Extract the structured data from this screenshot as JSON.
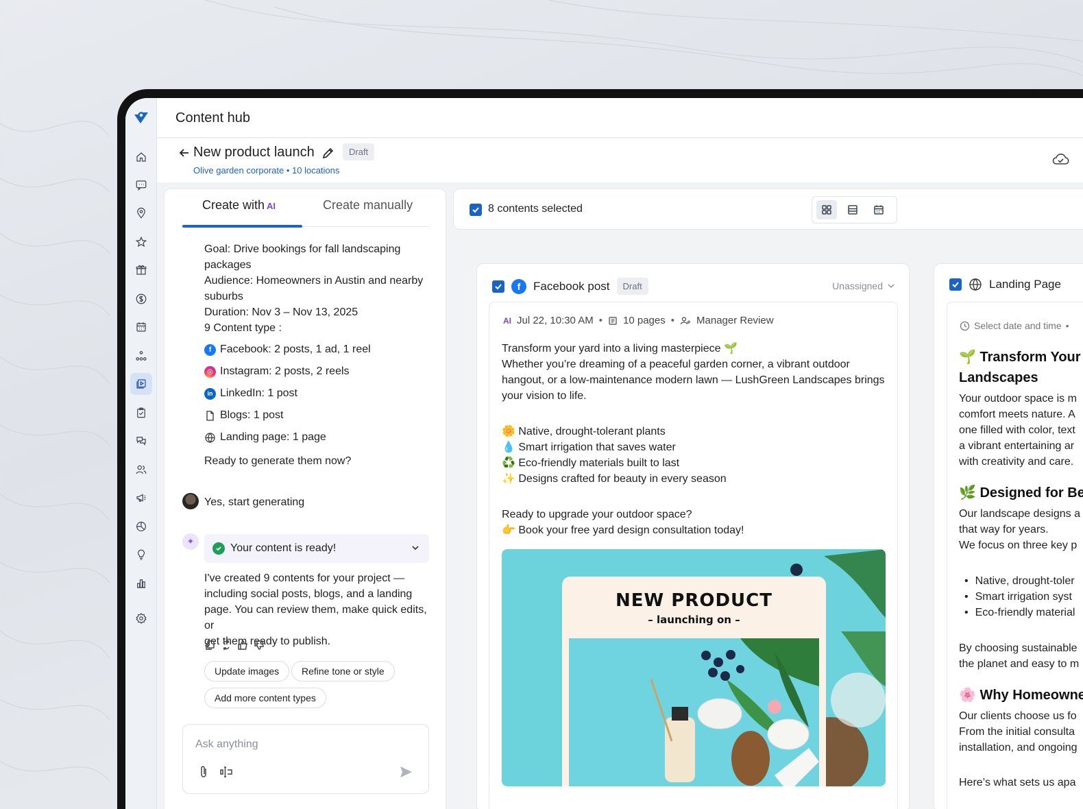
{
  "app": {
    "title": "Content hub"
  },
  "project": {
    "title": "New product launch",
    "status": "Draft",
    "subtitle": "Olive garden corporate • 10 locations"
  },
  "sidebar": {
    "items": [
      {
        "icon": "home-icon"
      },
      {
        "icon": "messages-icon"
      },
      {
        "icon": "location-icon"
      },
      {
        "icon": "star-icon"
      },
      {
        "icon": "gift-icon"
      },
      {
        "icon": "dollar-icon"
      },
      {
        "icon": "calendar-icon"
      },
      {
        "icon": "network-icon"
      },
      {
        "icon": "content-icon",
        "active": true
      },
      {
        "icon": "checklist-icon"
      },
      {
        "icon": "chat-icon"
      },
      {
        "icon": "users-icon"
      },
      {
        "icon": "megaphone-icon"
      },
      {
        "icon": "pie-chart-icon"
      },
      {
        "icon": "lightbulb-icon"
      },
      {
        "icon": "bar-chart-icon"
      },
      {
        "icon": "settings-icon"
      }
    ]
  },
  "left_panel": {
    "tabs": [
      {
        "label": "Create with",
        "ai_mark": "AI",
        "active": true
      },
      {
        "label": "Create manually",
        "active": false
      }
    ],
    "brief": [
      "Goal: Drive bookings for fall landscaping",
      "packages",
      "Audience: Homeowners in Austin and nearby",
      "suburbs",
      "Duration: Nov 3 – Nov 13, 2025",
      "9 Content type :"
    ],
    "content_types": [
      {
        "icon": "facebook-icon",
        "label": "Facebook: 2 posts, 1 ad, 1 reel"
      },
      {
        "icon": "instagram-icon",
        "label": "Instagram: 2 posts, 2 reels"
      },
      {
        "icon": "linkedin-icon",
        "label": "LinkedIn: 1 post"
      },
      {
        "icon": "document-icon",
        "label": "Blogs: 1 post"
      },
      {
        "icon": "globe-icon",
        "label": "Landing page: 1 page"
      }
    ],
    "question": "Ready to generate them now?",
    "user_reply": "Yes, start generating",
    "ready_label": "Your content is ready!",
    "ai_message": [
      "I've created 9 contents for your project —",
      "including social posts, blogs, and a landing",
      "page. You can review them, make quick edits, or",
      "get them ready to publish."
    ],
    "chips": [
      "Update images",
      "Refine tone or style",
      "Add more content types"
    ],
    "input_placeholder": "Ask anything"
  },
  "selection": {
    "text": "8 contents selected"
  },
  "facebook_card": {
    "type_label": "Facebook post",
    "status": "Draft",
    "assignee": "Unassigned",
    "ai_mark": "AI",
    "date": "Jul 22, 10:30 AM",
    "pages": "10 pages",
    "review": "Manager Review",
    "post_lines": [
      "Transform your yard into a living masterpiece 🌱",
      " Whether you’re dreaming of a peaceful garden corner, a vibrant outdoor",
      "hangout, or a low-maintenance modern lawn — LushGreen Landscapes brings",
      "your vision to life."
    ],
    "features": [
      "🌼 Native, drought-tolerant plants",
      "💧 Smart irrigation that saves water",
      "♻️ Eco-friendly materials built to last",
      "✨ Designs crafted for beauty in every season"
    ],
    "cta_lines": [
      "Ready to upgrade your outdoor space?",
      "👉 Book your free yard design consultation today!"
    ],
    "image_title": "NEW PRODUCT",
    "image_subtitle": "– launching on –"
  },
  "landing_card": {
    "type_label": "Landing Page",
    "date_placeholder": "Select date and time",
    "h1_a": "🌱 Transform Your Y",
    "h1_b": "Landscapes",
    "p1": [
      "Your outdoor space is m",
      "comfort meets nature. A",
      "one filled with color, text",
      "a vibrant entertaining ar",
      "with creativity and care."
    ],
    "h2": "🌿 Designed for Bea",
    "p2": [
      "Our landscape designs a",
      "that way for years.",
      " We focus on three key p"
    ],
    "bullets": [
      "Native, drought-toler",
      "Smart irrigation syst",
      "Eco-friendly material"
    ],
    "p3": [
      "By choosing sustainable",
      "the planet and easy to m"
    ],
    "h3": "🌸 Why Homeowne",
    "p4": [
      "Our clients choose us fo",
      " From the initial consulta",
      "installation, and ongoing"
    ],
    "p5": "Here’s what sets us apa"
  },
  "colors": {
    "accent": "#1a64c4",
    "ai_purple": "#7b45d6",
    "success": "#1e9e57"
  }
}
